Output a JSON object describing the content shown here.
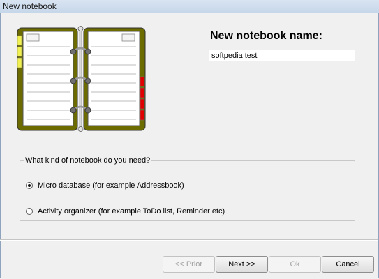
{
  "window": {
    "title": "New notebook"
  },
  "form": {
    "name_label": "New notebook name:",
    "name_value": "softpedia test"
  },
  "kind_group": {
    "legend": "What kind of notebook do you need?",
    "options": [
      {
        "label": "Micro database (for example Addressbook)",
        "selected": true
      },
      {
        "label": "Activity organizer (for example ToDo list, Reminder etc)",
        "selected": false
      }
    ]
  },
  "buttons": {
    "prev": "<< Prior",
    "next": "Next >>",
    "ok": "Ok",
    "cancel": "Cancel"
  },
  "colors": {
    "notebook_cover": "#6b6b00",
    "left_tabs": "#f0f050",
    "right_tabs": "#e00000",
    "page": "#ffffff"
  }
}
